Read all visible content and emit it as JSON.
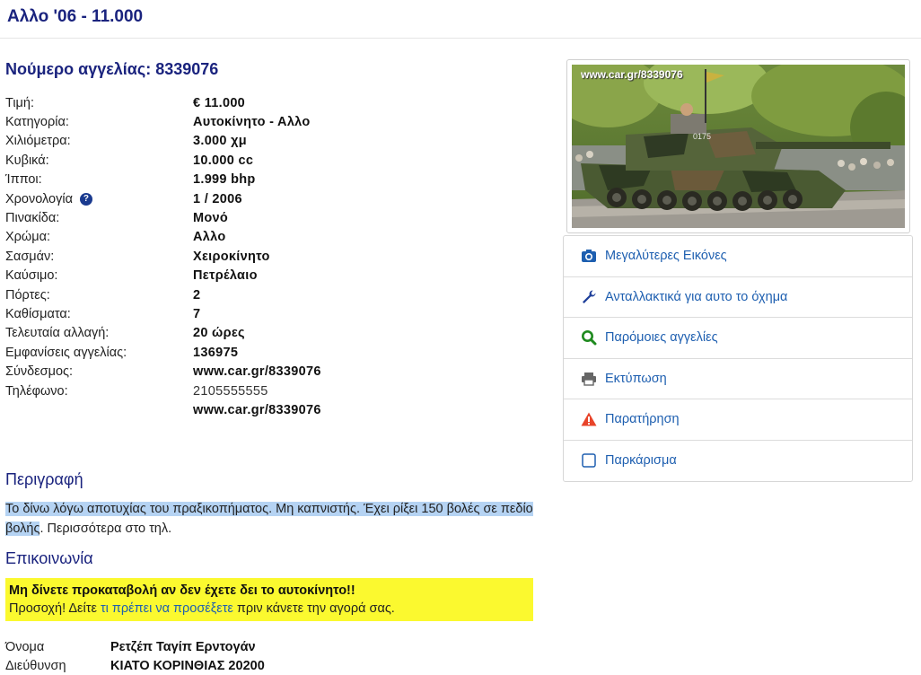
{
  "page": {
    "title": "Αλλο '06 - 11.000"
  },
  "ad": {
    "number_label": "Νούμερο αγγελίας: 8339076"
  },
  "specs": [
    {
      "label": "Τιμή:",
      "value": "€ 11.000"
    },
    {
      "label": "Κατηγορία:",
      "value": "Αυτοκίνητο - Αλλο"
    },
    {
      "label": "Χιλιόμετρα:",
      "value": "3.000 χμ"
    },
    {
      "label": "Κυβικά:",
      "value": "10.000 cc"
    },
    {
      "label": "Ίπποι:",
      "value": "1.999 bhp"
    },
    {
      "label": "Χρονολογία",
      "value": "1 / 2006"
    },
    {
      "label": "Πινακίδα:",
      "value": "Μονό"
    },
    {
      "label": "Χρώμα:",
      "value": "Αλλο"
    },
    {
      "label": "Σασμάν:",
      "value": "Χειροκίνητο"
    },
    {
      "label": "Καύσιμο:",
      "value": "Πετρέλαιο"
    },
    {
      "label": "Πόρτες:",
      "value": "2"
    },
    {
      "label": "Καθίσματα:",
      "value": "7"
    },
    {
      "label": "Τελευταία αλλαγή:",
      "value": "20 ώρες"
    },
    {
      "label": "Εμφανίσεις αγγελίας:",
      "value": "136975"
    },
    {
      "label": "Σύνδεσμος:",
      "value": "www.car.gr/8339076"
    },
    {
      "label": "Τηλέφωνο:",
      "value": "2105555555"
    },
    {
      "label": "",
      "value": "www.car.gr/8339076"
    }
  ],
  "photo": {
    "watermark": "www.car.gr/8339076",
    "turret_number": "0175"
  },
  "actions": [
    {
      "label": "Μεγαλύτερες Εικόνες",
      "icon": "camera-icon"
    },
    {
      "label": "Ανταλλακτικά για αυτο το όχημα",
      "icon": "wrench-icon"
    },
    {
      "label": "Παρόμοιες αγγελίες",
      "icon": "search-icon"
    },
    {
      "label": "Εκτύπωση",
      "icon": "printer-icon"
    },
    {
      "label": "Παρατήρηση",
      "icon": "warning-icon"
    },
    {
      "label": "Παρκάρισμα",
      "icon": "checkbox-icon"
    }
  ],
  "description": {
    "heading": "Περιγραφή",
    "highlighted": "Το δίνω λόγω αποτυχίας του πραξικοπήματος. Μη καπνιστής. Έχει ρίξει 150 βολές σε πεδίο βολής",
    "rest": ". Περισσότερα στο τηλ."
  },
  "contact": {
    "heading": "Επικοινωνία",
    "warning_title": "Μη δίνετε προκαταβολή αν δεν έχετε δει το αυτοκίνητο!!",
    "warning_prefix": "Προσοχή! Δείτε ",
    "warning_link": "τι πρέπει να προσέξετε",
    "warning_suffix": " πριν κάνετε την αγορά σας.",
    "rows": [
      {
        "label": "Όνομα",
        "value": "Ρετζέπ Ταγίπ Ερντογάν"
      },
      {
        "label": "Διεύθυνση",
        "value": "ΚΙΑΤΟ ΚΟΡΙΝΘΙΑΣ 20200"
      }
    ]
  },
  "colors": {
    "heading": "#1a237e",
    "link": "#1e5fb0",
    "warning_bg": "#fbf92f",
    "selection": "#b5d3f3"
  }
}
